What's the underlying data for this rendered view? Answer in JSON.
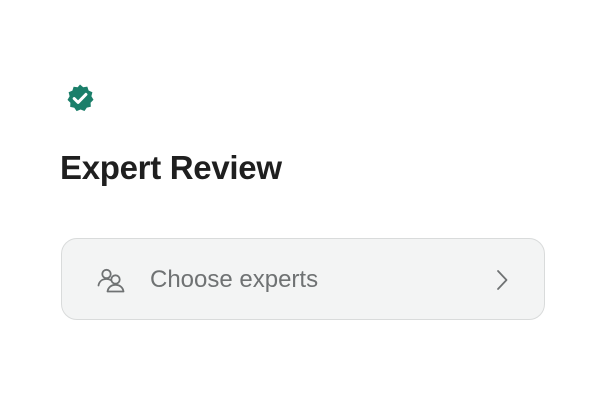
{
  "header": {
    "badge_icon": "verified-badge-icon",
    "badge_color": "#1b7f6a",
    "title": "Expert Review"
  },
  "selector": {
    "icon": "people-icon",
    "label": "Choose experts",
    "chevron_icon": "chevron-right-icon"
  },
  "colors": {
    "title": "#1f1f1f",
    "selector_background": "#f3f4f4",
    "selector_border": "#d9dbdb",
    "selector_text": "#6f7273"
  }
}
